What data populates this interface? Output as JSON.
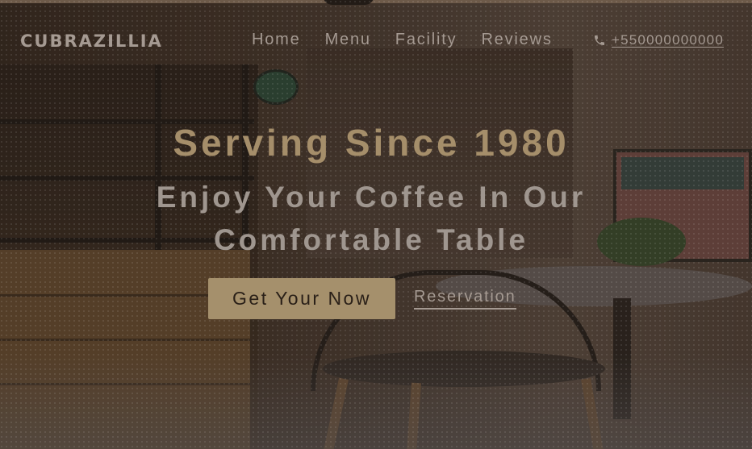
{
  "brand": {
    "name": "CUBRAZILLIA"
  },
  "nav": {
    "links": [
      {
        "label": "Home"
      },
      {
        "label": "Menu"
      },
      {
        "label": "Facility"
      },
      {
        "label": "Reviews"
      }
    ],
    "phone": {
      "icon": "phone-icon",
      "number": "+550000000000"
    }
  },
  "hero": {
    "headline": "Serving Since 1980",
    "subline": "Enjoy Your Coffee In Our Comfortable Table",
    "cta_label": "Get Your Now",
    "reservation_label": "Reservation"
  },
  "colors": {
    "accent": "#a5906c",
    "headline": "#a58e6a",
    "nav_text": "#a59a92"
  }
}
